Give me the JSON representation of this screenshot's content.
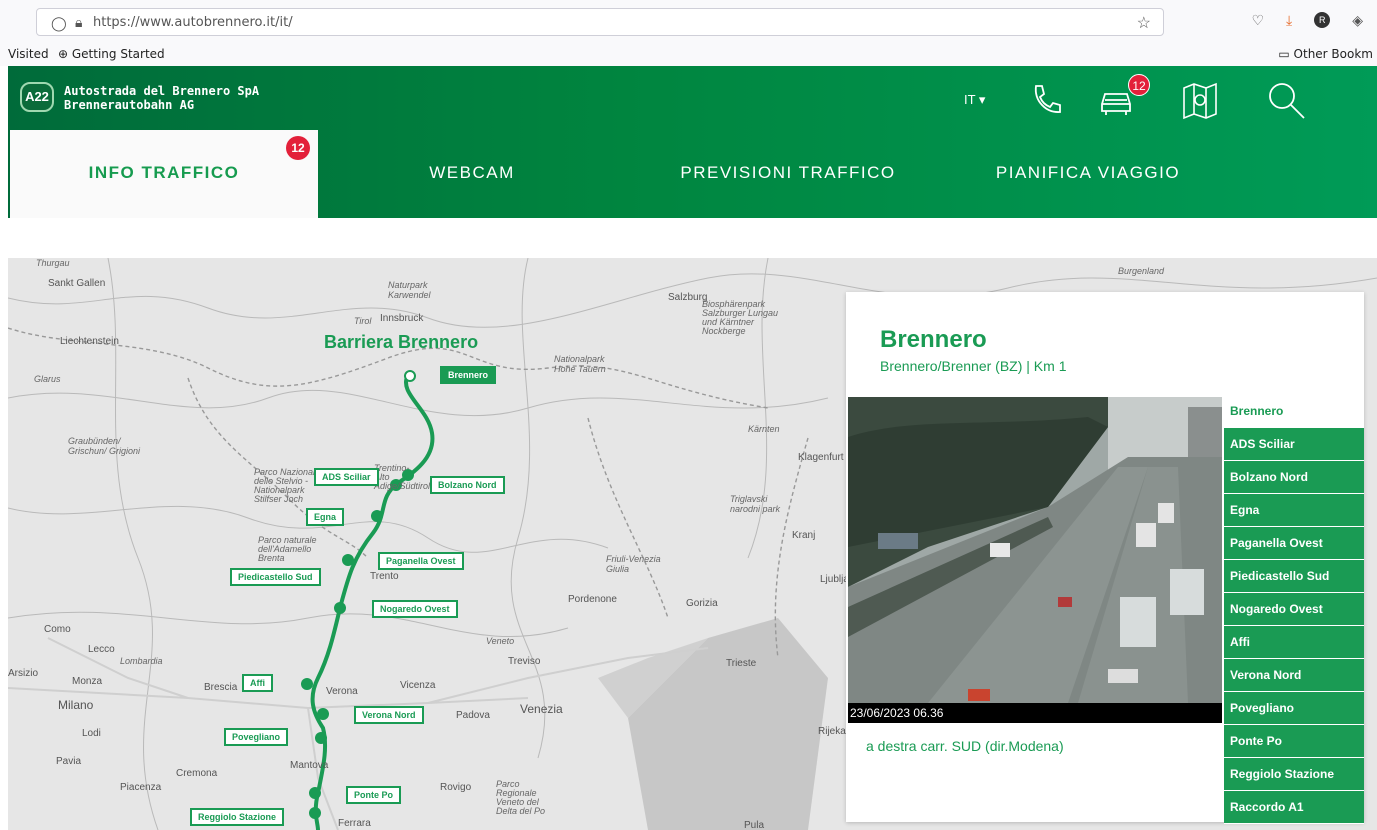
{
  "browser": {
    "url": "https://www.autobrennero.it/it/",
    "bookmarks": [
      "Visited",
      "Getting Started",
      "Other Bookm"
    ]
  },
  "header": {
    "logo": "A22",
    "company_line1": "Autostrada del Brennero SpA",
    "company_line2": "Brennerautobahn AG",
    "language": "IT ▾",
    "traffic_badge": "12",
    "colors": {
      "primary": "#00853f",
      "accent": "#1a9b54",
      "badge": "#e3203a"
    }
  },
  "tabs": [
    {
      "label": "INFO TRAFFICO",
      "active": true,
      "badge": "12"
    },
    {
      "label": "WEBCAM",
      "active": false
    },
    {
      "label": "PREVISIONI TRAFFICO",
      "active": false
    },
    {
      "label": "PIANIFICA VIAGGIO",
      "active": false
    }
  ],
  "map": {
    "title": "Barriera Brennero",
    "places": [
      "Sankt Gallen",
      "Liechtenstein",
      "Innsbruck",
      "Salzburg",
      "Burgenland",
      "Glarus",
      "Graubünden/ Grischun/ Grigioni",
      "Kärnten",
      "Klagenfurt",
      "Kranj",
      "Ljubljana",
      "Gorizia",
      "Trieste",
      "Pordenone",
      "Treviso",
      "Veneto",
      "Venezia",
      "Padova",
      "Vicenza",
      "Verona",
      "Brescia",
      "Milano",
      "Lodi",
      "Pavia",
      "Cremona",
      "Piacenza",
      "Mantova",
      "Rovigo",
      "Lecco",
      "Como",
      "Lombardia",
      "Trento",
      "Monza",
      "Friuli-Venezia Giulia",
      "Rijeka",
      "Pula",
      "Naturpark Karwendel",
      "Tirol",
      "Biosphärenpark Salzburger Lungau und Kärntner Nockberge",
      "Nationalpark Hohe Tauern",
      "Parco Nazionale dello Stelvio - Nationalpark Stilfser Joch",
      "Parco naturale dell'Adamello Brenta",
      "Trentino-Alto Adige/Südtirol",
      "Triglavski narodni park",
      "Parco Regionale Veneto del Delta del Po",
      "Thurgau",
      "Arsizio",
      "Ferrara"
    ],
    "stops": [
      "Brennero",
      "ADS Sciliar",
      "Bolzano Nord",
      "Egna",
      "Paganella Ovest",
      "Piedicastello Sud",
      "Nogaredo Ovest",
      "Affi",
      "Verona Nord",
      "Povegliano",
      "Ponte Po",
      "Reggiolo Stazione"
    ]
  },
  "webcam": {
    "title": "Brennero",
    "subtitle": "Brennero/Brenner (BZ) | Km 1",
    "timestamp": "23/06/2023  06.36",
    "caption": "a destra carr. SUD (dir.Modena)",
    "list": [
      "Brennero",
      "ADS Sciliar",
      "Bolzano Nord",
      "Egna",
      "Paganella Ovest",
      "Piedicastello Sud",
      "Nogaredo Ovest",
      "Affi",
      "Verona Nord",
      "Povegliano",
      "Ponte Po",
      "Reggiolo Stazione",
      "Raccordo A1"
    ]
  }
}
